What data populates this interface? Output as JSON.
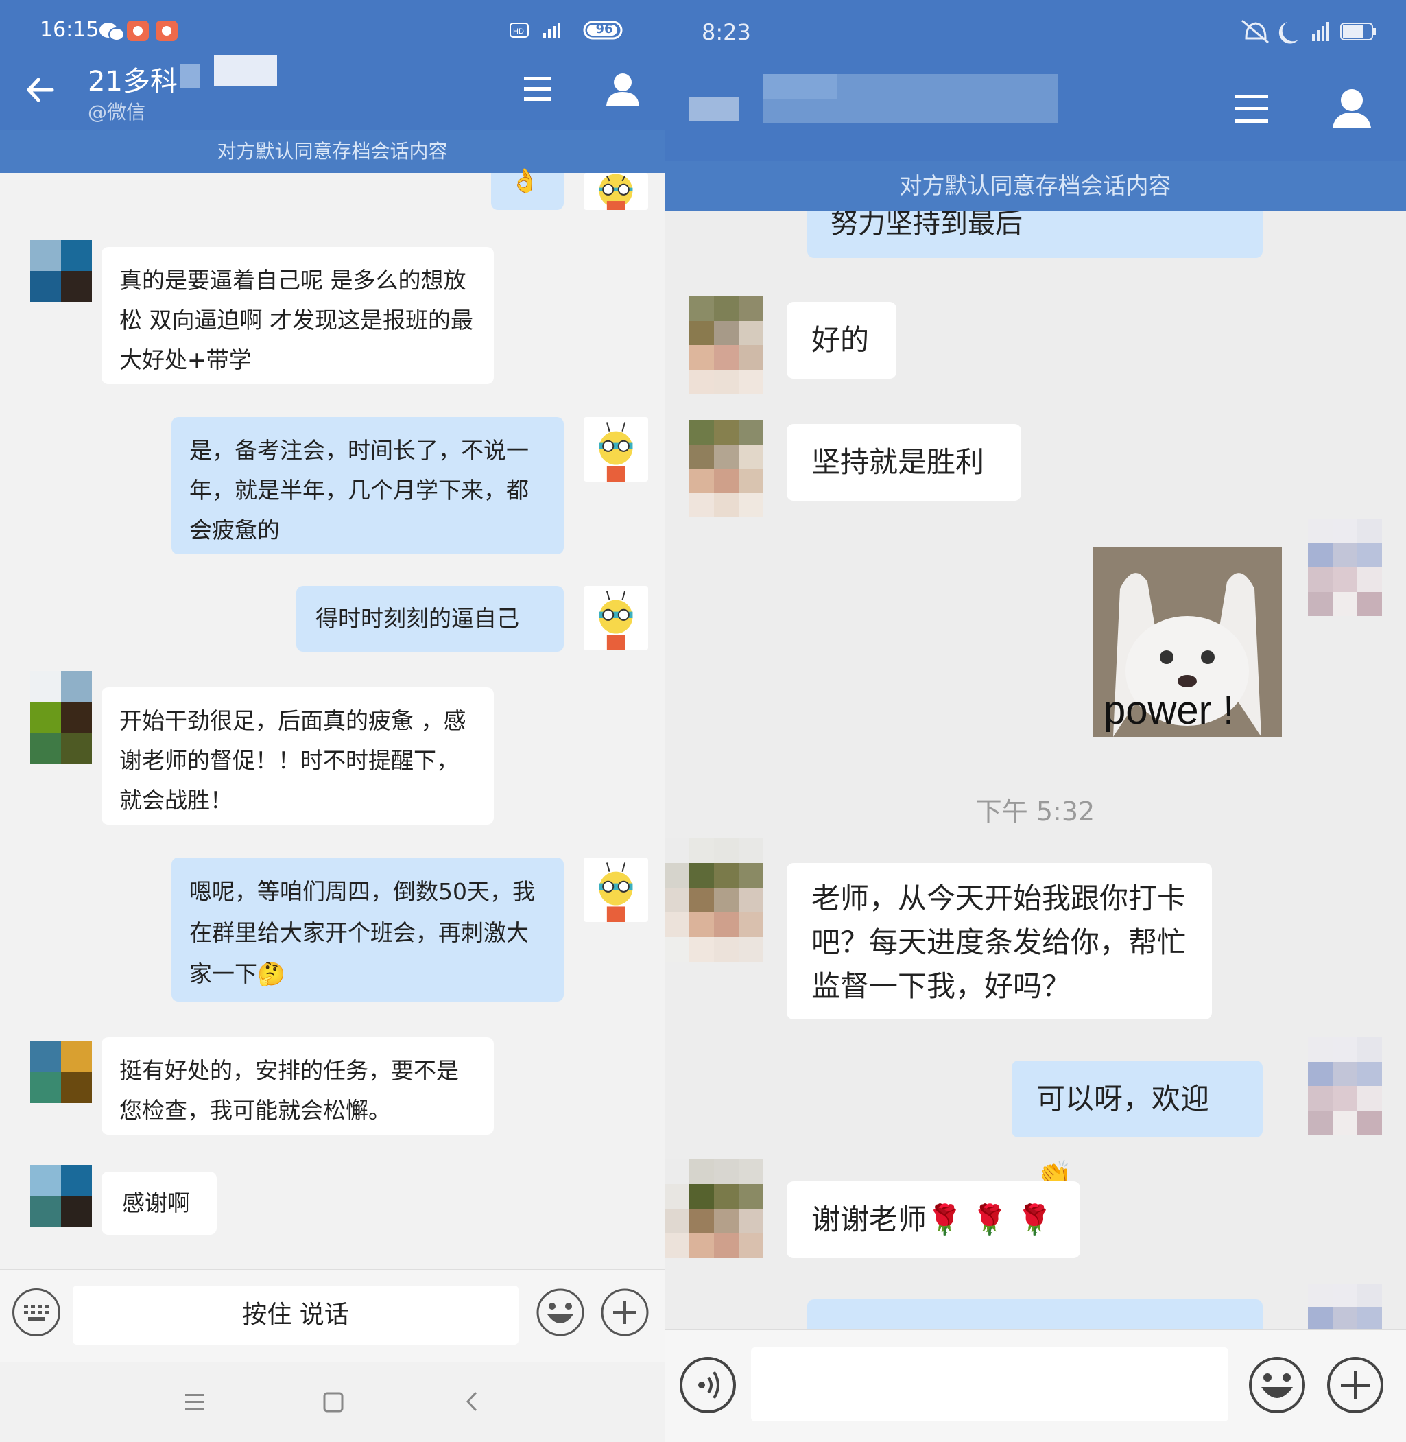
{
  "left": {
    "status": {
      "time": "16:15",
      "battery": "96"
    },
    "header": {
      "title": "21多科",
      "subtitle": "@微信"
    },
    "notice": "对方默认同意存档会话内容",
    "messages": [
      {
        "from": "them",
        "text": "真的是要逼着自己呢   是多么的想放松  双向逼迫啊   才发现这是报班的最大好处+带学"
      },
      {
        "from": "me",
        "text": "是，备考注会，时间长了，不说一年，就是半年，几个月学下来，都会疲惫的"
      },
      {
        "from": "me",
        "text": "得时时刻刻的逼自己"
      },
      {
        "from": "them",
        "text": "开始干劲很足，后面真的疲惫  ，感谢老师的督促！！时不时提醒下，就会战胜！"
      },
      {
        "from": "me",
        "text": "嗯呢，等咱们周四，倒数50天，我在群里给大家开个班会，再刺激大家一下",
        "emoji": "🤔"
      },
      {
        "from": "them",
        "text": "挺有好处的，安排的任务，要不是您检查，我可能就会松懈。"
      },
      {
        "from": "them",
        "text": "感谢啊"
      }
    ],
    "input": {
      "hold_to_talk": "按住 说话"
    }
  },
  "right": {
    "status": {
      "time": "8:23"
    },
    "notice": "对方默认同意存档会话内容",
    "messages": [
      {
        "from": "me",
        "text": "努力坚持到最后"
      },
      {
        "from": "them",
        "text": "好的"
      },
      {
        "from": "them",
        "text": "坚持就是胜利"
      },
      {
        "from": "me",
        "type": "sticker",
        "text": "power !"
      },
      {
        "type": "time",
        "text": "下午 5:32"
      },
      {
        "from": "them",
        "text": "老师，从今天开始我跟你打卡吧？每天进度条发给你，帮忙监督一下我，好吗？"
      },
      {
        "from": "me",
        "text": "可以呀，欢迎",
        "emoji": "👏"
      },
      {
        "from": "them",
        "text": "谢谢老师",
        "emoji": "🌹 🌹 🌹"
      }
    ]
  },
  "colors": {
    "header_blue": "#4678c2",
    "bubble_blue": "#cfe5fb",
    "bubble_white": "#ffffff"
  }
}
